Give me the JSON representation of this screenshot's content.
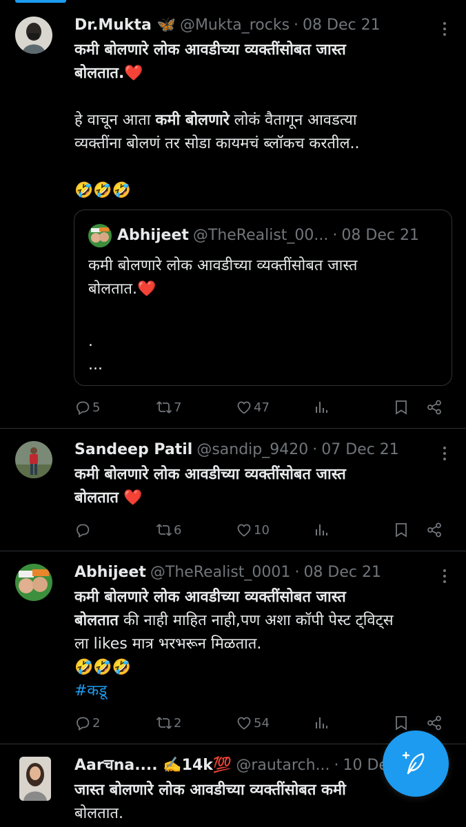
{
  "tweets": [
    {
      "name": "Dr.Mukta 🦋",
      "handle": "@Mukta_rocks",
      "date": "08 Dec 21",
      "line1_bold": "कमी बोलणारे लोक आवडीच्या व्यक्तींसोबत जास्त",
      "line2_bold": "बोलतात.",
      "heart": "❤️",
      "line3_pre": "हे वाचून आता ",
      "line3_bold": "कमी बोलणारे",
      "line3_post": " लोकं वैतागून आवडत्या",
      "line4": "व्यक्तींना बोलणं तर सोडा कायमचं ब्लॉकच करतील..",
      "emojis": "🤣🤣🤣",
      "replies": "5",
      "retweets": "7",
      "likes": "47",
      "quote": {
        "name": "Abhijeet",
        "handle": "@TheRealist_00...",
        "date": "08 Dec 21",
        "line1": "कमी बोलणारे लोक आवडीच्या व्यक्तींसोबत जास्त",
        "line2": "बोलतात.",
        "heart": "❤️",
        "line3": ".",
        "line4": "..."
      }
    },
    {
      "name": "Sandeep Patil",
      "handle": "@sandip_9420",
      "date": "07 Dec 21",
      "line1_bold": "कमी बोलणारे लोक आवडीच्या व्यक्तींसोबत जास्त",
      "line2_bold": "बोलतात",
      "heart": "❤️",
      "replies": "",
      "retweets": "6",
      "likes": "10"
    },
    {
      "name": "Abhijeet",
      "handle": "@TheRealist_0001",
      "date": "08 Dec 21",
      "line1_bold": "कमी बोलणारे लोक आवडीच्या व्यक्तींसोबत जास्त",
      "line2_bold": "बोलतात",
      "line2_post": " की नाही माहित नाही,पण अशा कॉपी पेस्ट ट्विट्स",
      "line3": "ला likes मात्र भरभरून मिळतात.",
      "emojis": "🤣🤣🤣",
      "hashtag": "#कडू",
      "replies": "2",
      "retweets": "2",
      "likes": "54"
    },
    {
      "name": "Aarचna.... ✍️14k💯",
      "handle": "@rautarch...",
      "date": "10 De",
      "line1_bold": "जास्त बोलणारे लोक आवडीच्या व्यक्तींसोबत कमी",
      "line2": "बोलतात."
    }
  ],
  "icons": {
    "reply": "reply-icon",
    "retweet": "retweet-icon",
    "like": "heart-icon",
    "views": "views-icon",
    "bookmark": "bookmark-icon",
    "share": "share-icon",
    "compose": "compose-tweet-icon"
  },
  "colors": {
    "accent": "#1d9bf0",
    "muted": "#71767b",
    "text": "#e7e9ea",
    "border": "#2f3336",
    "heart": "#f91880"
  }
}
